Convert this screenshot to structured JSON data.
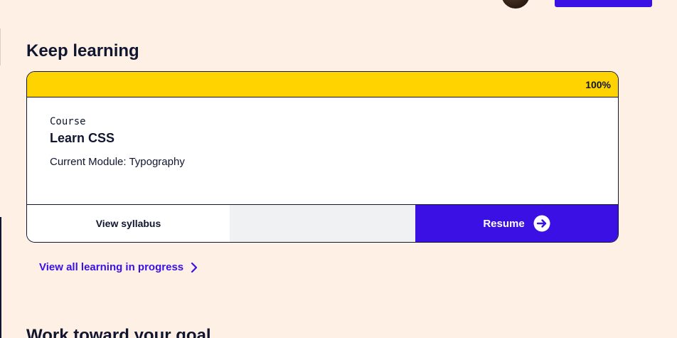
{
  "header": {
    "partial_nav_text": "",
    "upgrade_button_label": ""
  },
  "keep_learning": {
    "title": "Keep learning",
    "card": {
      "progress_percent": 100,
      "progress_label": "100%",
      "content_type": "Course",
      "course_title": "Learn CSS",
      "current_module": "Current Module: Typography",
      "syllabus_label": "View syllabus",
      "resume_label": "Resume"
    },
    "view_all_label": "View all learning in progress"
  },
  "next_section": {
    "title": "Work toward your goal"
  },
  "colors": {
    "background": "#fff0e5",
    "progress": "#ffd300",
    "accent": "#3a10e5",
    "text": "#10162f"
  }
}
